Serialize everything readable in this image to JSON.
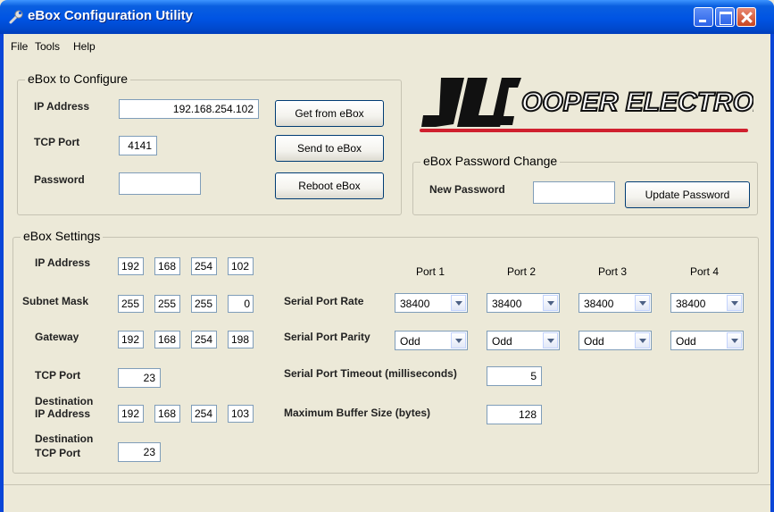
{
  "window": {
    "title": "eBox Configuration Utility"
  },
  "menu": {
    "file": "File",
    "tools": "Tools",
    "help": "Help"
  },
  "configure": {
    "title": "eBox to Configure",
    "ip_label": "IP Address",
    "ip_value": "192.168.254.102",
    "port_label": "TCP Port",
    "port_value": "4141",
    "password_label": "Password",
    "password_value": "",
    "get_button": "Get from eBox",
    "send_button": "Send to eBox",
    "reboot_button": "Reboot eBox"
  },
  "logo": {
    "text_main": "OOPER ELECTRONICS",
    "brand_color": "#d0202e"
  },
  "password_change": {
    "title": "eBox Password Change",
    "new_label": "New Password",
    "new_value": "",
    "update_button": "Update Password"
  },
  "settings": {
    "title": "eBox Settings",
    "ip_label": "IP Address",
    "ip": [
      "192",
      "168",
      "254",
      "102"
    ],
    "subnet_label": "Subnet Mask",
    "subnet": [
      "255",
      "255",
      "255",
      "0"
    ],
    "gateway_label": "Gateway",
    "gateway": [
      "192",
      "168",
      "254",
      "198"
    ],
    "tcp_port_label": "TCP Port",
    "tcp_port": "23",
    "dest_ip_label_1": "Destination",
    "dest_ip_label_2": "IP Address",
    "dest_ip": [
      "192",
      "168",
      "254",
      "103"
    ],
    "dest_port_label_1": "Destination",
    "dest_port_label_2": "TCP Port",
    "dest_port": "23",
    "ports": [
      "Port 1",
      "Port 2",
      "Port 3",
      "Port 4"
    ],
    "rate_label": "Serial Port Rate",
    "rates": [
      "38400",
      "38400",
      "38400",
      "38400"
    ],
    "parity_label": "Serial Port Parity",
    "parities": [
      "Odd",
      "Odd",
      "Odd",
      "Odd"
    ],
    "timeout_label": "Serial Port Timeout (milliseconds)",
    "timeout": "5",
    "buffer_label": "Maximum Buffer Size (bytes)",
    "buffer": "128"
  },
  "status": {
    "text": ""
  }
}
